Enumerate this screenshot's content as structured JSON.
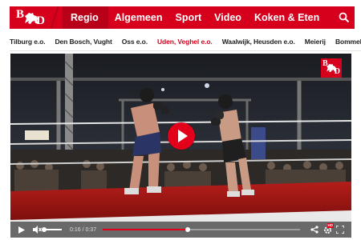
{
  "brand": {
    "logo_text": "BD",
    "accent": "#d6001c"
  },
  "nav": {
    "items": [
      {
        "label": "Regio",
        "active": true
      },
      {
        "label": "Algemeen"
      },
      {
        "label": "Sport"
      },
      {
        "label": "Video"
      },
      {
        "label": "Koken & Eten"
      }
    ],
    "search_icon": "search-icon"
  },
  "subnav": {
    "items": [
      {
        "label": "Tilburg e.o."
      },
      {
        "label": "Den Bosch, Vught"
      },
      {
        "label": "Oss e.o."
      },
      {
        "label": "Uden, Veghel e.o.",
        "active": true
      },
      {
        "label": "Waalwijk, Heusden e.o."
      },
      {
        "label": "Meierij"
      },
      {
        "label": "Bommelerwaard"
      }
    ]
  },
  "video": {
    "watermark": "BD",
    "time_display": "0:16 / 0:37",
    "progress": 0.432,
    "volume": 0.0,
    "icons": [
      "play-icon",
      "volume-icon",
      "share-icon",
      "hd-settings-icon",
      "fullscreen-icon"
    ],
    "hd_label": "HD"
  }
}
